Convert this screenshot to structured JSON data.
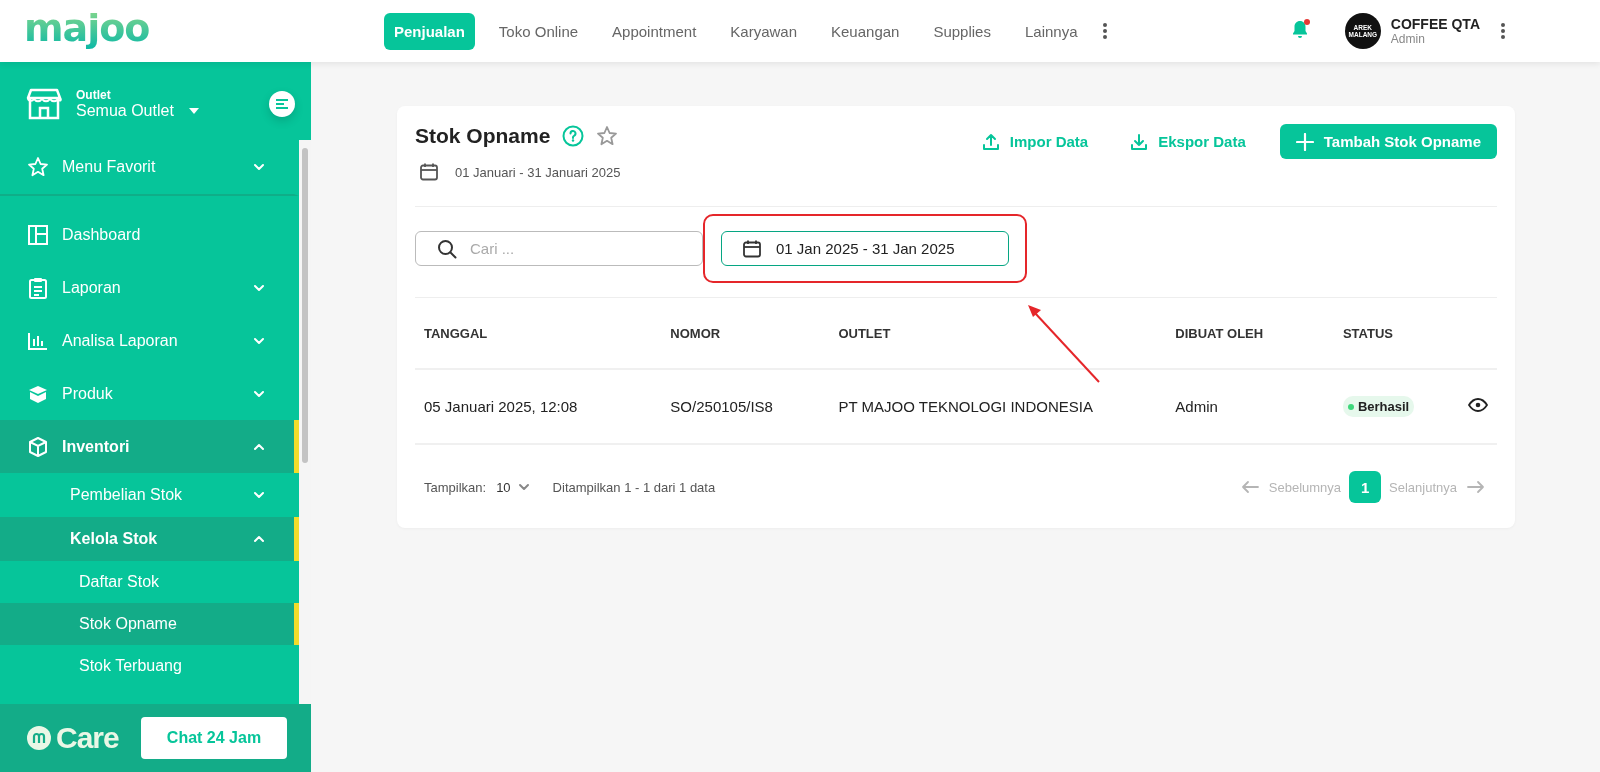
{
  "logo": {
    "text": "majoo"
  },
  "top_nav": {
    "tabs": [
      {
        "label": "Penjualan",
        "selected": true
      },
      {
        "label": "Toko Online",
        "selected": false
      },
      {
        "label": "Appointment",
        "selected": false
      },
      {
        "label": "Karyawan",
        "selected": false
      },
      {
        "label": "Keuangan",
        "selected": false
      },
      {
        "label": "Supplies",
        "selected": false
      },
      {
        "label": "Lainnya",
        "selected": false
      }
    ],
    "notification": {
      "unread": true
    },
    "account": {
      "avatar_lines": [
        "AREK",
        "MALANG"
      ],
      "name": "COFFEE QTA",
      "role": "Admin"
    }
  },
  "sidebar": {
    "outlet": {
      "label": "Outlet",
      "value": "Semua Outlet"
    },
    "favorite": {
      "label": "Menu Favorit",
      "expanded": false
    },
    "items": [
      {
        "label": "Dashboard",
        "kind": "link",
        "selected": false
      },
      {
        "label": "Laporan",
        "kind": "group",
        "expanded": false,
        "selected": false
      },
      {
        "label": "Analisa Laporan",
        "kind": "group",
        "expanded": false,
        "selected": false
      },
      {
        "label": "Produk",
        "kind": "group",
        "expanded": false,
        "selected": false
      },
      {
        "label": "Inventori",
        "kind": "group",
        "expanded": true,
        "selected": true,
        "children": [
          {
            "label": "Pembelian Stok",
            "kind": "group",
            "expanded": false,
            "selected": false
          },
          {
            "label": "Kelola Stok",
            "kind": "group",
            "expanded": true,
            "selected": true,
            "children": [
              {
                "label": "Daftar Stok",
                "kind": "link",
                "selected": false
              },
              {
                "label": "Stok Opname",
                "kind": "link",
                "selected": true
              },
              {
                "label": "Stok Terbuang",
                "kind": "link",
                "selected": false
              }
            ]
          }
        ]
      }
    ],
    "footer": {
      "brand": "Care",
      "button": "Chat 24 Jam"
    }
  },
  "page": {
    "title": "Stok Opname",
    "favorite": false,
    "period": "01 Januari - 31 Januari 2025",
    "actions": [
      {
        "label": "Impor Data",
        "kind": "import"
      },
      {
        "label": "Ekspor Data",
        "kind": "export"
      },
      {
        "label": "Tambah Stok Opname",
        "kind": "add"
      }
    ],
    "search": {
      "placeholder": "Cari ..."
    },
    "date_range": {
      "value": "01 Jan 2025 - 31 Jan 2025",
      "highlighted": true
    },
    "table": {
      "columns": [
        "TANGGAL",
        "NOMOR",
        "OUTLET",
        "DIBUAT OLEH",
        "STATUS"
      ],
      "rows": [
        {
          "cells": [
            "05 Januari 2025, 12:08",
            "SO/250105/IS8",
            "PT MAJOO TEKNOLOGI INDONESIA",
            "Admin"
          ],
          "status": {
            "text": "Berhasil",
            "color": "#3ed77b"
          }
        }
      ]
    },
    "pagination": {
      "page_size_label": "Tampilkan:",
      "page_size": "10",
      "summary": "Ditampilkan 1 - 1 dari 1 data",
      "prev": {
        "label": "Sebelumnya",
        "disabled": true
      },
      "pages": [
        {
          "label": "1",
          "selected": true
        }
      ],
      "next": {
        "label": "Selanjutnya",
        "disabled": true
      }
    }
  }
}
